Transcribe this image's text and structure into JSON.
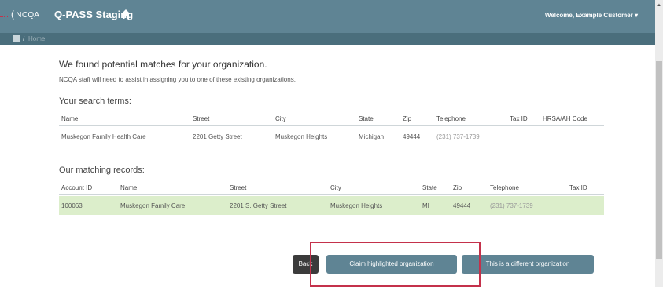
{
  "header": {
    "logo_text": "NCQA",
    "app_title": "Q-PASS Staging",
    "welcome_text": "Welcome, Example Customer",
    "welcome_caret": "▾"
  },
  "breadcrumb": {
    "separator": "/",
    "home_label": "Home"
  },
  "page": {
    "heading": "We found potential matches for your organization.",
    "subtext": "NCQA staff will need to assist in assigning you to one of these existing organizations."
  },
  "search_terms": {
    "title": "Your search terms:",
    "columns": [
      "Name",
      "Street",
      "City",
      "State",
      "Zip",
      "Telephone",
      "Tax ID",
      "HRSA/AH Code"
    ],
    "row": [
      "Muskegon Family Health Care",
      "2201 Getty Street",
      "Muskegon Heights",
      "Michigan",
      "49444",
      "(231) 737-1739",
      "",
      ""
    ]
  },
  "matching_records": {
    "title": "Our matching records:",
    "columns": [
      "Account ID",
      "Name",
      "Street",
      "City",
      "State",
      "Zip",
      "Telephone",
      "Tax ID"
    ],
    "rows": [
      [
        "100063",
        "Muskegon Family Care",
        "2201 S. Getty Street",
        "Muskegon Heights",
        "MI",
        "49444",
        "(231) 737-1739",
        ""
      ]
    ]
  },
  "actions": {
    "back_label": "Back",
    "claim_label": "Claim highlighted organization",
    "different_label": "This is a different organization"
  },
  "colors": {
    "header_bg": "#5f8494",
    "breadcrumb_bg": "#4a6e7c",
    "row_highlight": "#dceecb",
    "annotation": "#c4314b"
  },
  "icons": {
    "home": "home-icon",
    "menu": "menu-icon"
  }
}
